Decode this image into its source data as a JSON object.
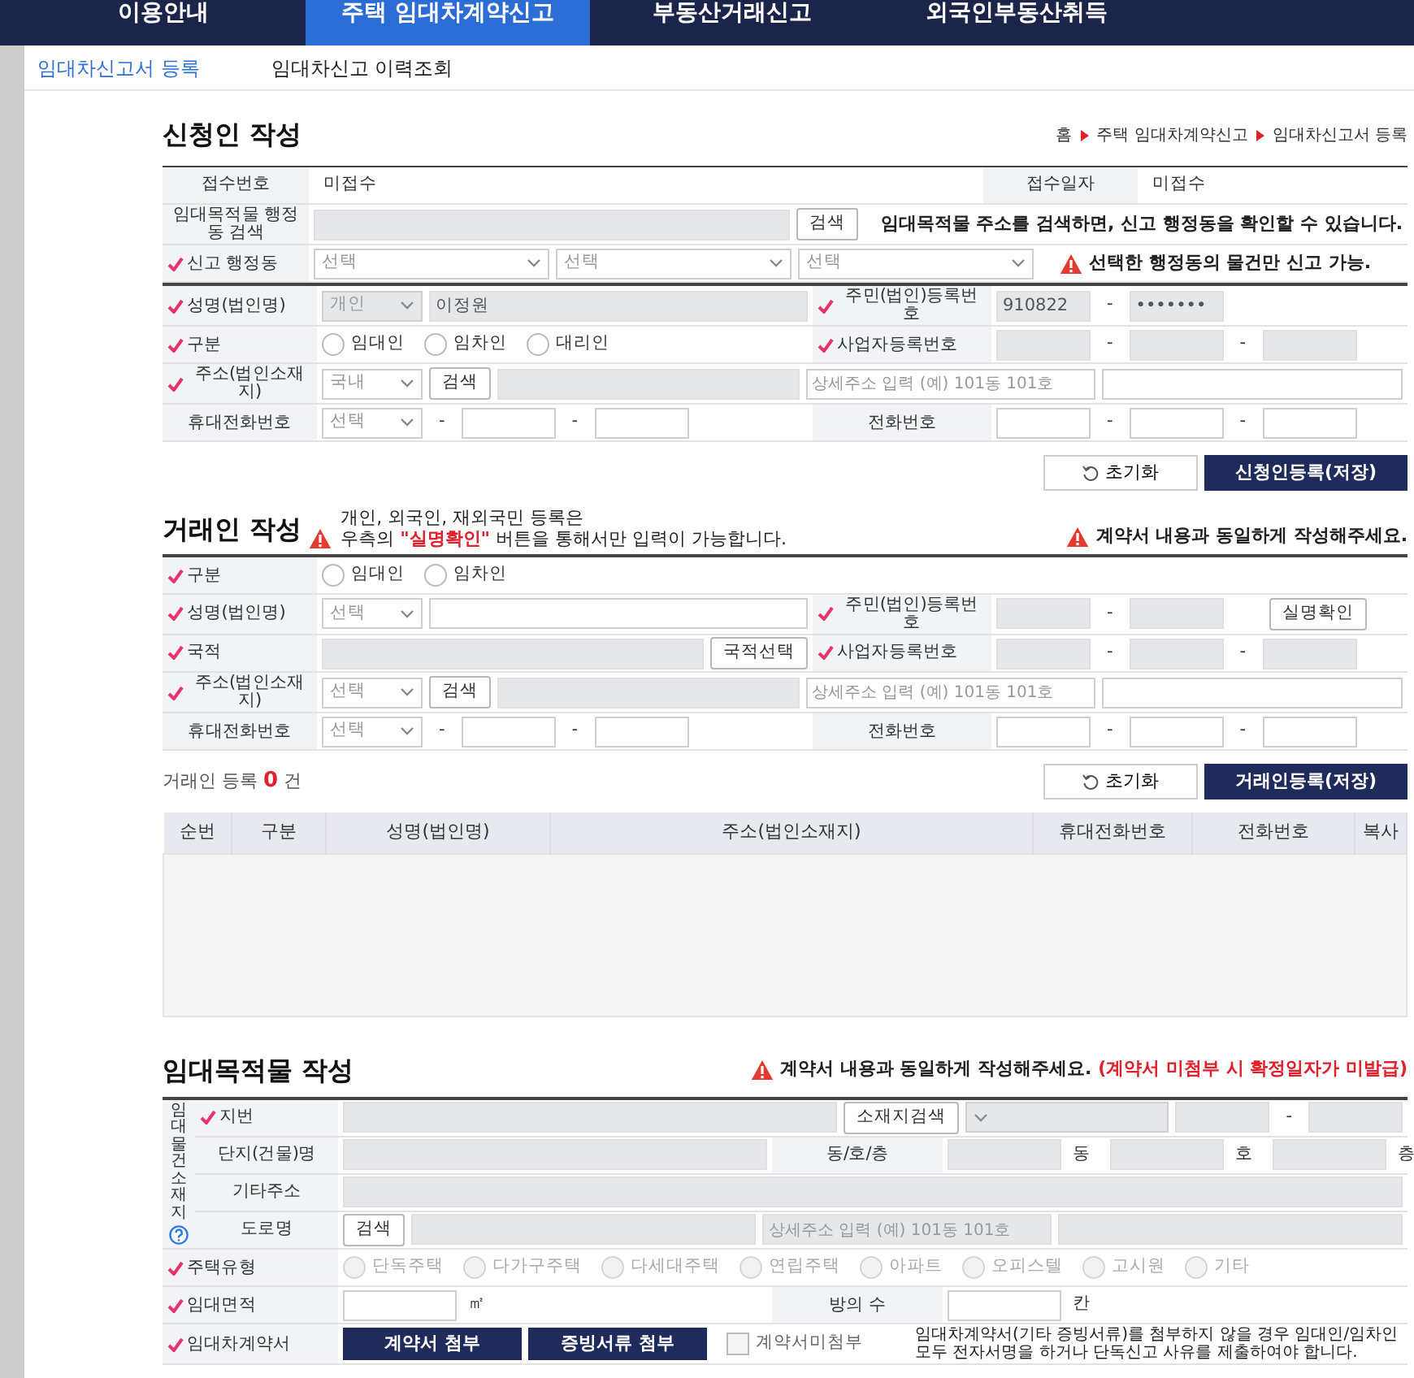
{
  "top_nav": [
    {
      "label": "이용안내",
      "selected": false
    },
    {
      "label": "주택 임대차계약신고",
      "selected": true
    },
    {
      "label": "부동산거래신고",
      "selected": false
    },
    {
      "label": "외국인부동산취득",
      "selected": false
    }
  ],
  "sub_nav": [
    {
      "label": "임대차신고서 등록",
      "selected": true
    },
    {
      "label": "임대차신고 이력조회",
      "selected": false
    }
  ],
  "applicant": {
    "title": "신청인 작성",
    "breadcrumb": [
      "홈",
      "주택 임대차계약신고",
      "임대차신고서 등록"
    ],
    "reception_rows": [
      {
        "cells": [
          {
            "kind": "head",
            "text": "접수번호",
            "required": false
          },
          {
            "kind": "body",
            "items": [
              {
                "kind": "text",
                "text": "미접수"
              }
            ]
          },
          {
            "kind": "head",
            "text": "접수일자",
            "required": false
          },
          {
            "kind": "body",
            "items": [
              {
                "kind": "text",
                "text": "미접수"
              }
            ]
          }
        ]
      },
      {
        "cells": [
          {
            "kind": "head",
            "text": "임대목적물 행정동 검색",
            "required": false
          },
          {
            "kind": "body",
            "colspan": 3,
            "items": [
              {
                "kind": "input",
                "disabled": true
              },
              {
                "kind": "button",
                "label": "검색"
              },
              {
                "kind": "note",
                "text": "임대목적물 주소를 검색하면, 신고 행정동을 확인할 수 있습니다."
              }
            ]
          }
        ]
      },
      {
        "cells": [
          {
            "kind": "head",
            "text": "신고 행정동",
            "required": true
          },
          {
            "kind": "body",
            "colspan": 3,
            "items": [
              {
                "kind": "select",
                "text": "선택",
                "disabled": false
              },
              {
                "kind": "select",
                "text": "선택",
                "disabled": false
              },
              {
                "kind": "select",
                "text": "선택",
                "disabled": false
              },
              {
                "kind": "warning",
                "text": "선택한 행정동의 물건만 신고 가능."
              }
            ]
          }
        ]
      }
    ],
    "rows": [
      {
        "cells": [
          {
            "kind": "head",
            "text": "성명(법인명)",
            "required": true
          },
          {
            "kind": "body",
            "items": [
              {
                "kind": "select",
                "text": "개인",
                "disabled": true
              },
              {
                "kind": "input",
                "value": "이정원",
                "disabled": true
              }
            ]
          },
          {
            "kind": "head",
            "text": "주민(법인)등록번호",
            "required": true
          },
          {
            "kind": "body",
            "items": [
              {
                "kind": "input",
                "value": "910822",
                "disabled": true
              },
              {
                "kind": "dash",
                "text": "-"
              },
              {
                "kind": "input",
                "value": "•••••••",
                "disabled": true
              }
            ]
          }
        ]
      },
      {
        "cells": [
          {
            "kind": "head",
            "text": "구분",
            "required": true
          },
          {
            "kind": "body",
            "items": [
              {
                "kind": "radio",
                "label": "임대인",
                "selected": false,
                "disabled": false
              },
              {
                "kind": "radio",
                "label": "임차인",
                "selected": false,
                "disabled": false
              },
              {
                "kind": "radio",
                "label": "대리인",
                "selected": false,
                "disabled": false
              }
            ]
          },
          {
            "kind": "head",
            "text": "사업자등록번호",
            "required": true
          },
          {
            "kind": "body",
            "items": [
              {
                "kind": "input",
                "disabled": true
              },
              {
                "kind": "dash",
                "text": "-"
              },
              {
                "kind": "input",
                "disabled": true
              },
              {
                "kind": "dash",
                "text": "-"
              },
              {
                "kind": "input",
                "disabled": true
              }
            ]
          }
        ]
      },
      {
        "cells": [
          {
            "kind": "head",
            "text": "주소(법인소재지)",
            "required": true
          },
          {
            "kind": "body",
            "colspan": 3,
            "items": [
              {
                "kind": "select",
                "text": "국내",
                "disabled": false
              },
              {
                "kind": "button",
                "label": "검색"
              },
              {
                "kind": "input",
                "disabled": true
              },
              {
                "kind": "input",
                "placeholder": "상세주소 입력 (예) 101동 101호",
                "disabled": false
              },
              {
                "kind": "input",
                "disabled": false
              }
            ]
          }
        ]
      },
      {
        "cells": [
          {
            "kind": "head",
            "text": "휴대전화번호",
            "required": false
          },
          {
            "kind": "body",
            "items": [
              {
                "kind": "select",
                "text": "선택",
                "disabled": false
              },
              {
                "kind": "dash",
                "text": "-"
              },
              {
                "kind": "input",
                "disabled": false
              },
              {
                "kind": "dash",
                "text": "-"
              },
              {
                "kind": "input",
                "disabled": false
              }
            ]
          },
          {
            "kind": "head",
            "text": "전화번호",
            "required": false
          },
          {
            "kind": "body",
            "items": [
              {
                "kind": "input",
                "disabled": false
              },
              {
                "kind": "dash",
                "text": "-"
              },
              {
                "kind": "input",
                "disabled": false
              },
              {
                "kind": "dash",
                "text": "-"
              },
              {
                "kind": "input",
                "disabled": false
              }
            ]
          }
        ]
      }
    ],
    "buttons": [
      {
        "kind": "reset",
        "label": "초기화"
      },
      {
        "kind": "save",
        "label": "신청인등록(저장)"
      }
    ]
  },
  "party": {
    "title": "거래인 작성",
    "notice": [
      "개인, 외국인, 재외국민 등록은",
      "우측의 **\"실명확인\"** 버튼을 통해서만 입력이 가능합니다."
    ],
    "warning": "계약서 내용과 동일하게 작성해주세요.",
    "rows": [
      {
        "cells": [
          {
            "kind": "head",
            "text": "구분",
            "required": true
          },
          {
            "kind": "body",
            "colspan": 3,
            "items": [
              {
                "kind": "radio",
                "label": "임대인",
                "selected": false,
                "disabled": false
              },
              {
                "kind": "radio",
                "label": "임차인",
                "selected": false,
                "disabled": false
              }
            ]
          }
        ]
      },
      {
        "cells": [
          {
            "kind": "head",
            "text": "성명(법인명)",
            "required": true
          },
          {
            "kind": "body",
            "items": [
              {
                "kind": "select",
                "text": "선택",
                "disabled": false
              },
              {
                "kind": "input",
                "disabled": false
              }
            ]
          },
          {
            "kind": "head",
            "text": "주민(법인)등록번호",
            "required": true
          },
          {
            "kind": "body",
            "items": [
              {
                "kind": "input",
                "disabled": true
              },
              {
                "kind": "dash",
                "text": "-"
              },
              {
                "kind": "input",
                "disabled": true
              },
              {
                "kind": "button",
                "label": "실명확인"
              }
            ]
          }
        ]
      },
      {
        "cells": [
          {
            "kind": "head",
            "text": "국적",
            "required": true
          },
          {
            "kind": "body",
            "items": [
              {
                "kind": "input",
                "disabled": true
              },
              {
                "kind": "button",
                "label": "국적선택"
              }
            ]
          },
          {
            "kind": "head",
            "text": "사업자등록번호",
            "required": true
          },
          {
            "kind": "body",
            "items": [
              {
                "kind": "input",
                "disabled": true
              },
              {
                "kind": "dash",
                "text": "-"
              },
              {
                "kind": "input",
                "disabled": true
              },
              {
                "kind": "dash",
                "text": "-"
              },
              {
                "kind": "input",
                "disabled": true
              }
            ]
          }
        ]
      },
      {
        "cells": [
          {
            "kind": "head",
            "text": "주소(법인소재지)",
            "required": true
          },
          {
            "kind": "body",
            "colspan": 3,
            "items": [
              {
                "kind": "select",
                "text": "선택",
                "disabled": false
              },
              {
                "kind": "button",
                "label": "검색"
              },
              {
                "kind": "input",
                "disabled": true
              },
              {
                "kind": "input",
                "placeholder": "상세주소 입력 (예) 101동 101호",
                "disabled": false
              },
              {
                "kind": "input",
                "disabled": false
              }
            ]
          }
        ]
      },
      {
        "cells": [
          {
            "kind": "head",
            "text": "휴대전화번호",
            "required": false
          },
          {
            "kind": "body",
            "items": [
              {
                "kind": "select",
                "text": "선택",
                "disabled": false
              },
              {
                "kind": "dash",
                "text": "-"
              },
              {
                "kind": "input",
                "disabled": false
              },
              {
                "kind": "dash",
                "text": "-"
              },
              {
                "kind": "input",
                "disabled": false
              }
            ]
          },
          {
            "kind": "head",
            "text": "전화번호",
            "required": false
          },
          {
            "kind": "body",
            "items": [
              {
                "kind": "input",
                "disabled": false
              },
              {
                "kind": "dash",
                "text": "-"
              },
              {
                "kind": "input",
                "disabled": false
              },
              {
                "kind": "dash",
                "text": "-"
              },
              {
                "kind": "input",
                "disabled": false
              }
            ]
          }
        ]
      }
    ],
    "count": "거래인 등록 **0** 건",
    "buttons": [
      {
        "kind": "reset",
        "label": "초기화"
      },
      {
        "kind": "save",
        "label": "거래인등록(저장)"
      }
    ],
    "list": {
      "columns": [
        "순번",
        "구분",
        "성명(법인명)",
        "주소(법인소재지)",
        "휴대전화번호",
        "전화번호",
        "복사"
      ]
    }
  },
  "property": {
    "title": "임대목적물 작성",
    "warning": "계약서 내용과 동일하게 작성해주세요.",
    "warning_red": "(계약서 미첨부 시 확정일자가 미발급)",
    "group": {
      "label": "임대물건소재지",
      "rows": [
        {
          "cells": [
            {
              "kind": "head",
              "text": "지번",
              "required": true
            },
            {
              "kind": "body",
              "colspan": 3,
              "items": [
                {
                  "kind": "input",
                  "disabled": true
                },
                {
                  "kind": "button",
                  "label": "소재지검색"
                },
                {
                  "kind": "select",
                  "disabled": true
                },
                {
                  "kind": "input",
                  "disabled": true
                },
                {
                  "kind": "dash",
                  "text": "-"
                },
                {
                  "kind": "input",
                  "disabled": true
                }
              ]
            }
          ]
        },
        {
          "cells": [
            {
              "kind": "head",
              "text": "단지(건물)명",
              "required": false
            },
            {
              "kind": "body",
              "items": [
                {
                  "kind": "input",
                  "disabled": true
                }
              ]
            },
            {
              "kind": "head",
              "text": "동/호/층",
              "required": false
            },
            {
              "kind": "body",
              "items": [
                {
                  "kind": "input",
                  "disabled": true
                },
                {
                  "kind": "unit",
                  "text": "동"
                },
                {
                  "kind": "input",
                  "disabled": true
                },
                {
                  "kind": "unit",
                  "text": "호"
                },
                {
                  "kind": "input",
                  "disabled": true
                },
                {
                  "kind": "unit",
                  "text": "층"
                }
              ]
            }
          ]
        },
        {
          "cells": [
            {
              "kind": "head",
              "text": "기타주소",
              "required": false
            },
            {
              "kind": "body",
              "colspan": 3,
              "items": [
                {
                  "kind": "input",
                  "disabled": true
                }
              ]
            }
          ]
        },
        {
          "cells": [
            {
              "kind": "head",
              "text": "도로명",
              "required": false
            },
            {
              "kind": "body",
              "colspan": 3,
              "items": [
                {
                  "kind": "button",
                  "label": "검색"
                },
                {
                  "kind": "input",
                  "disabled": true
                },
                {
                  "kind": "input",
                  "placeholder": "상세주소 입력 (예) 101동 101호",
                  "disabled": true
                },
                {
                  "kind": "input",
                  "disabled": true
                }
              ]
            }
          ]
        }
      ]
    },
    "rows": [
      {
        "cells": [
          {
            "kind": "head",
            "text": "주택유형",
            "required": true,
            "colspan": 2
          },
          {
            "kind": "body",
            "colspan": 3,
            "items": [
              {
                "kind": "radio",
                "label": "단독주택",
                "selected": false,
                "disabled": true
              },
              {
                "kind": "radio",
                "label": "다가구주택",
                "selected": false,
                "disabled": true
              },
              {
                "kind": "radio",
                "label": "다세대주택",
                "selected": false,
                "disabled": true
              },
              {
                "kind": "radio",
                "label": "연립주택",
                "selected": false,
                "disabled": true
              },
              {
                "kind": "radio",
                "label": "아파트",
                "selected": false,
                "disabled": true
              },
              {
                "kind": "radio",
                "label": "오피스텔",
                "selected": false,
                "disabled": true
              },
              {
                "kind": "radio",
                "label": "고시원",
                "selected": false,
                "disabled": true
              },
              {
                "kind": "radio",
                "label": "기타",
                "selected": false,
                "disabled": true
              }
            ]
          }
        ]
      },
      {
        "cells": [
          {
            "kind": "head",
            "text": "임대면적",
            "required": true,
            "colspan": 2
          },
          {
            "kind": "body",
            "items": [
              {
                "kind": "input",
                "disabled": false
              },
              {
                "kind": "unit",
                "text": "㎡"
              }
            ]
          },
          {
            "kind": "head",
            "text": "방의 수",
            "required": false
          },
          {
            "kind": "body",
            "items": [
              {
                "kind": "input",
                "disabled": false
              },
              {
                "kind": "unit",
                "text": "칸"
              }
            ]
          }
        ]
      },
      {
        "cells": [
          {
            "kind": "head",
            "text": "임대차계약서",
            "required": true,
            "colspan": 2
          },
          {
            "kind": "body",
            "colspan": 3,
            "items": [
              {
                "kind": "attach",
                "label": "계약서 첨부"
              },
              {
                "kind": "attach",
                "label": "증빙서류 첨부"
              },
              {
                "kind": "checkbox",
                "label": "계약서미첨부",
                "checked": false
              },
              {
                "kind": "info",
                "text": "임대차계약서(기타 증빙서류)를 첨부하지 않을 경우 임대인/임차인 모두 전자서명을 하거나 단독신고 사유를 제출하여야 합니다."
              }
            ]
          }
        ]
      }
    ]
  }
}
